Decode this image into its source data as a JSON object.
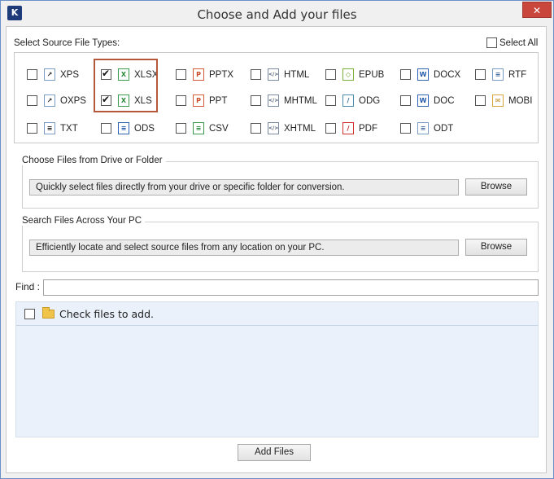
{
  "window": {
    "title": "Choose and Add your files",
    "app_icon_letter": "K",
    "close_symbol": "✕"
  },
  "source_types": {
    "label": "Select Source File Types:",
    "select_all_label": "Select All",
    "select_all_checked": false,
    "items": [
      {
        "label": "XPS",
        "icon": "xps-file-icon",
        "checked": false
      },
      {
        "label": "XLSX",
        "icon": "xlsx-file-icon",
        "checked": true
      },
      {
        "label": "PPTX",
        "icon": "pptx-file-icon",
        "checked": false
      },
      {
        "label": "HTML",
        "icon": "html-file-icon",
        "checked": false
      },
      {
        "label": "EPUB",
        "icon": "epub-file-icon",
        "checked": false
      },
      {
        "label": "DOCX",
        "icon": "docx-file-icon",
        "checked": false
      },
      {
        "label": "RTF",
        "icon": "rtf-file-icon",
        "checked": false
      },
      {
        "label": "OXPS",
        "icon": "oxps-file-icon",
        "checked": false
      },
      {
        "label": "XLS",
        "icon": "xls-file-icon",
        "checked": true
      },
      {
        "label": "PPT",
        "icon": "ppt-file-icon",
        "checked": false
      },
      {
        "label": "MHTML",
        "icon": "mhtml-file-icon",
        "checked": false
      },
      {
        "label": "ODG",
        "icon": "odg-file-icon",
        "checked": false
      },
      {
        "label": "DOC",
        "icon": "doc-file-icon",
        "checked": false
      },
      {
        "label": "MOBI",
        "icon": "mobi-file-icon",
        "checked": false
      },
      {
        "label": "TXT",
        "icon": "txt-file-icon",
        "checked": false
      },
      {
        "label": "ODS",
        "icon": "ods-file-icon",
        "checked": false
      },
      {
        "label": "CSV",
        "icon": "csv-file-icon",
        "checked": false
      },
      {
        "label": "XHTML",
        "icon": "xhtml-file-icon",
        "checked": false
      },
      {
        "label": "PDF",
        "icon": "pdf-file-icon",
        "checked": false
      },
      {
        "label": "ODT",
        "icon": "odt-file-icon",
        "checked": false
      }
    ]
  },
  "drive_group": {
    "label": "Choose Files from Drive or Folder",
    "field_text": "Quickly select files directly from your drive or specific folder for conversion.",
    "browse_label": "Browse"
  },
  "search_group": {
    "label": "Search Files Across Your PC",
    "field_text": "Efficiently locate and select source files from any location on your PC.",
    "browse_label": "Browse"
  },
  "find": {
    "label": "Find :",
    "value": ""
  },
  "files_list": {
    "header_label": "Check files to add.",
    "checked": false
  },
  "footer": {
    "add_files_label": "Add Files"
  },
  "colors": {
    "highlight_border": "#b5583a",
    "close_button": "#c9463d",
    "files_panel_bg": "#eaf1fa"
  }
}
